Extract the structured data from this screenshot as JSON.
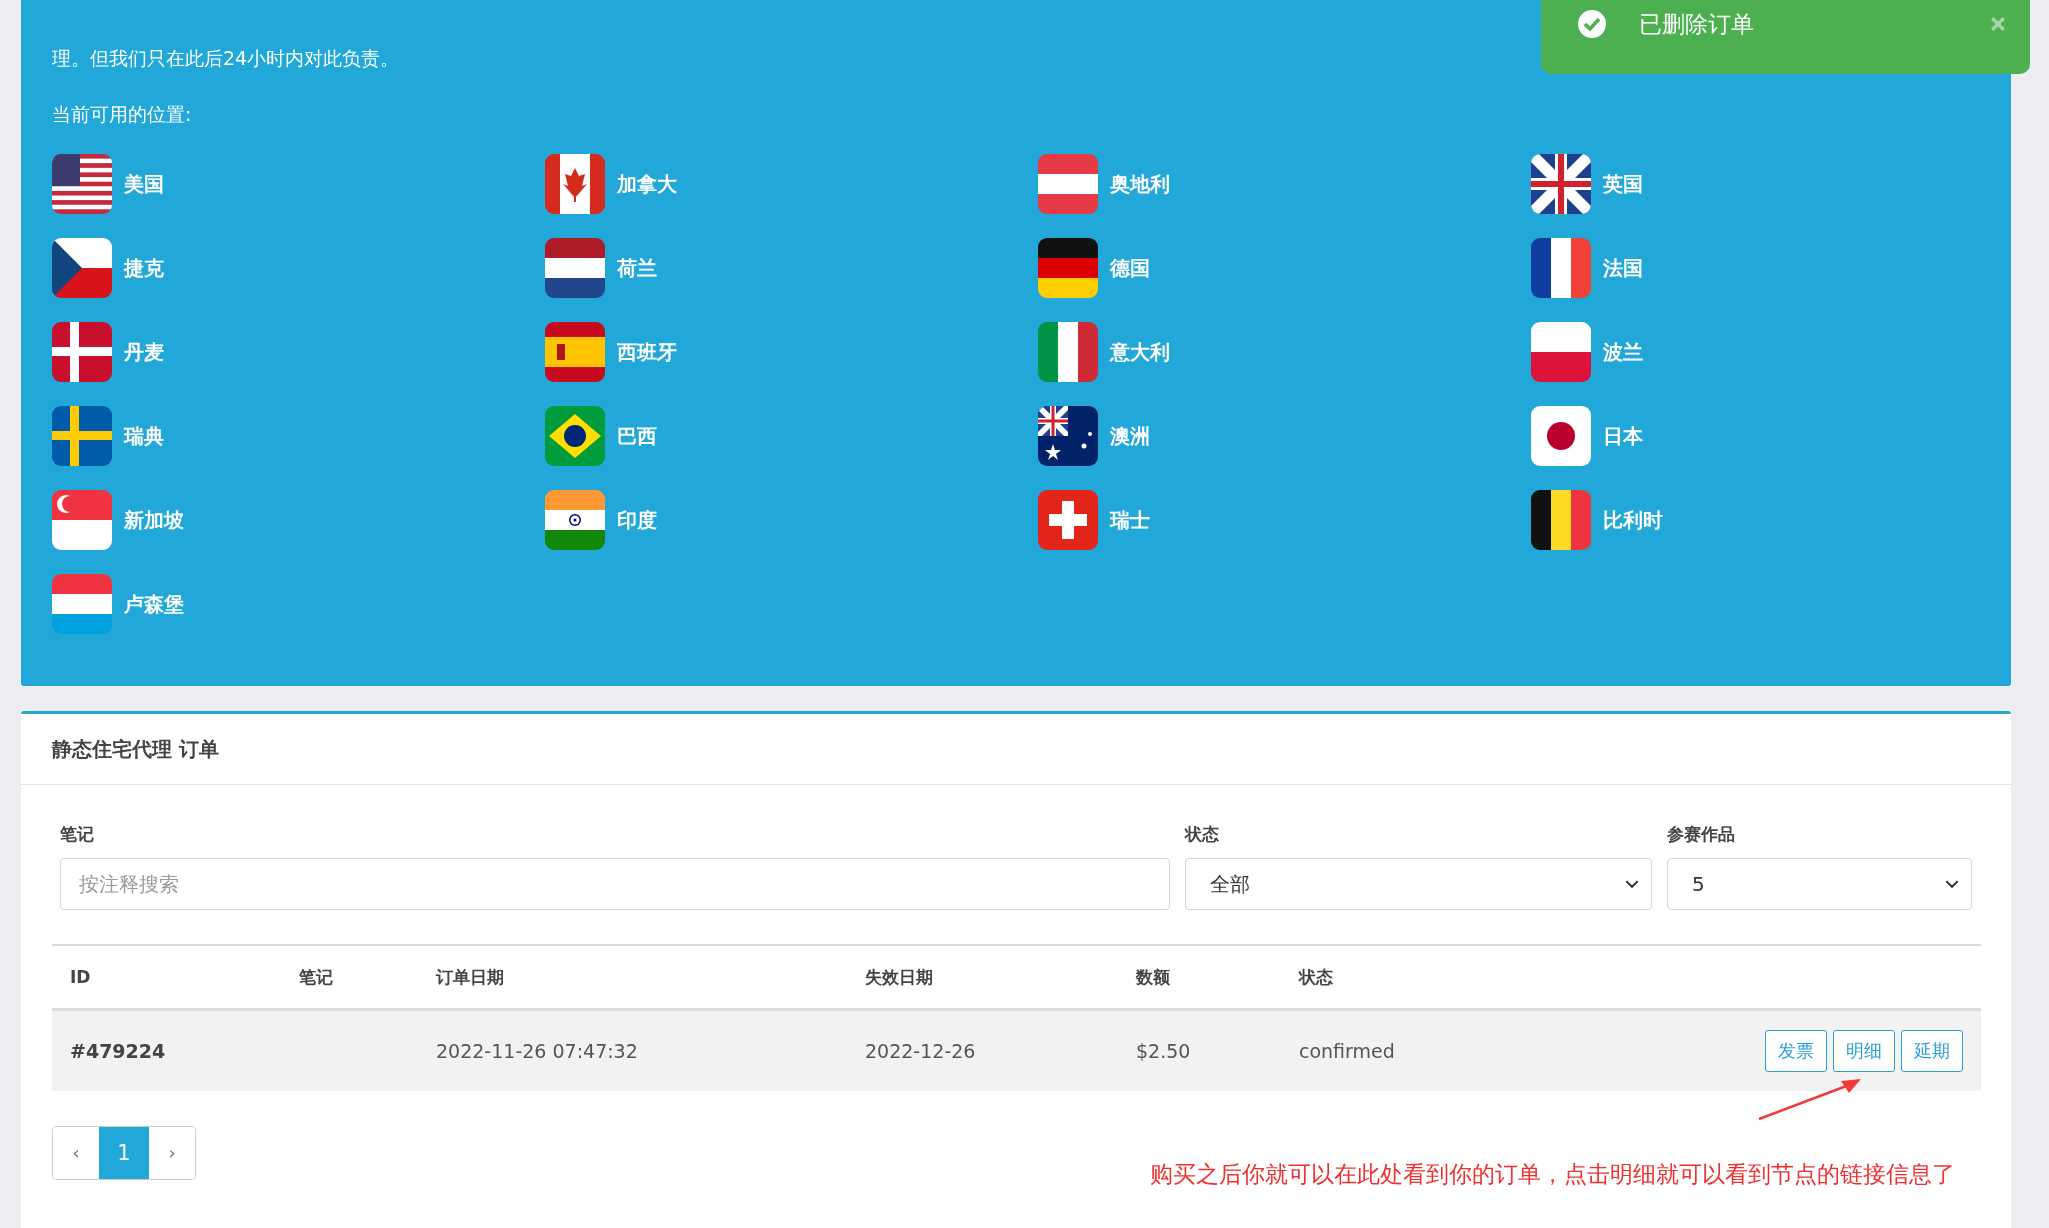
{
  "intro": {
    "text": "理。但我们只在此后24小时内对此负责。",
    "locations_label": "当前可用的位置:"
  },
  "locations": [
    {
      "name": "美国"
    },
    {
      "name": "加拿大"
    },
    {
      "name": "奥地利"
    },
    {
      "name": "英国"
    },
    {
      "name": "捷克"
    },
    {
      "name": "荷兰"
    },
    {
      "name": "德国"
    },
    {
      "name": "法国"
    },
    {
      "name": "丹麦"
    },
    {
      "name": "西班牙"
    },
    {
      "name": "意大利"
    },
    {
      "name": "波兰"
    },
    {
      "name": "瑞典"
    },
    {
      "name": "巴西"
    },
    {
      "name": "澳洲"
    },
    {
      "name": "日本"
    },
    {
      "name": "新加坡"
    },
    {
      "name": "印度"
    },
    {
      "name": "瑞士"
    },
    {
      "name": "比利时"
    },
    {
      "name": "卢森堡"
    }
  ],
  "toast": {
    "message": "已删除订单"
  },
  "orders": {
    "title": "静态住宅代理 订单",
    "filters": [
      {
        "kind": "text",
        "label": "笔记",
        "placeholder": "按注释搜索"
      },
      {
        "kind": "select",
        "label": "状态",
        "value": "全部"
      },
      {
        "kind": "select",
        "label": "参赛作品",
        "value": "5"
      }
    ],
    "table": {
      "columns": [
        "ID",
        "笔记",
        "订单日期",
        "失效日期",
        "数额",
        "状态"
      ],
      "rows": [
        {
          "id": "#479224",
          "order_date": "2022-11-26 07:47:32",
          "expiry_date": "2022-12-26",
          "amount": "$2.50",
          "status": "confirmed",
          "actions": [
            "发票",
            "明细",
            "延期"
          ]
        }
      ]
    },
    "pagination": {
      "prev": "‹",
      "pages": [
        {
          "label": "1",
          "selected": true
        }
      ],
      "next": "›"
    }
  },
  "annotation": {
    "text": "购买之后你就可以在此处看到你的订单，点击明细就可以看到节点的链接信息了"
  }
}
